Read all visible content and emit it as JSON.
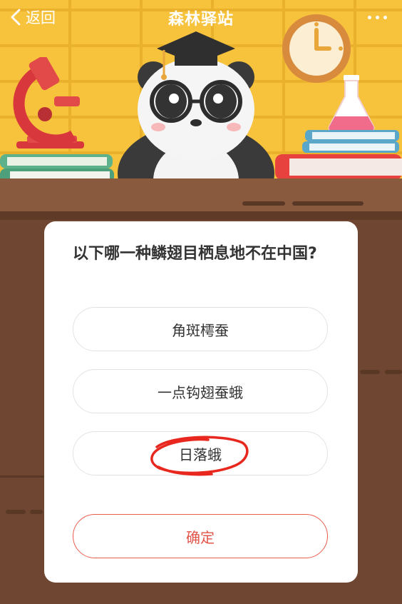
{
  "header": {
    "back_label": "返回",
    "title": "森林驿站"
  },
  "quiz": {
    "question": "以下哪一种鳞翅目栖息地不在中国?",
    "options": [
      "角斑樗蚕",
      "一点钩翅蚕蛾",
      "日落蛾"
    ],
    "marked_option_index": 2,
    "confirm_label": "确定"
  },
  "colors": {
    "wall": "#f7c33c",
    "desk": "#6f4632",
    "accent": "#e2544a",
    "annotation": "#e8281e"
  },
  "icons": [
    "back-chevron-icon",
    "more-dots-icon",
    "panda-graduate-illustration",
    "microscope-icon",
    "clock-icon",
    "flask-icon",
    "books-icon"
  ]
}
